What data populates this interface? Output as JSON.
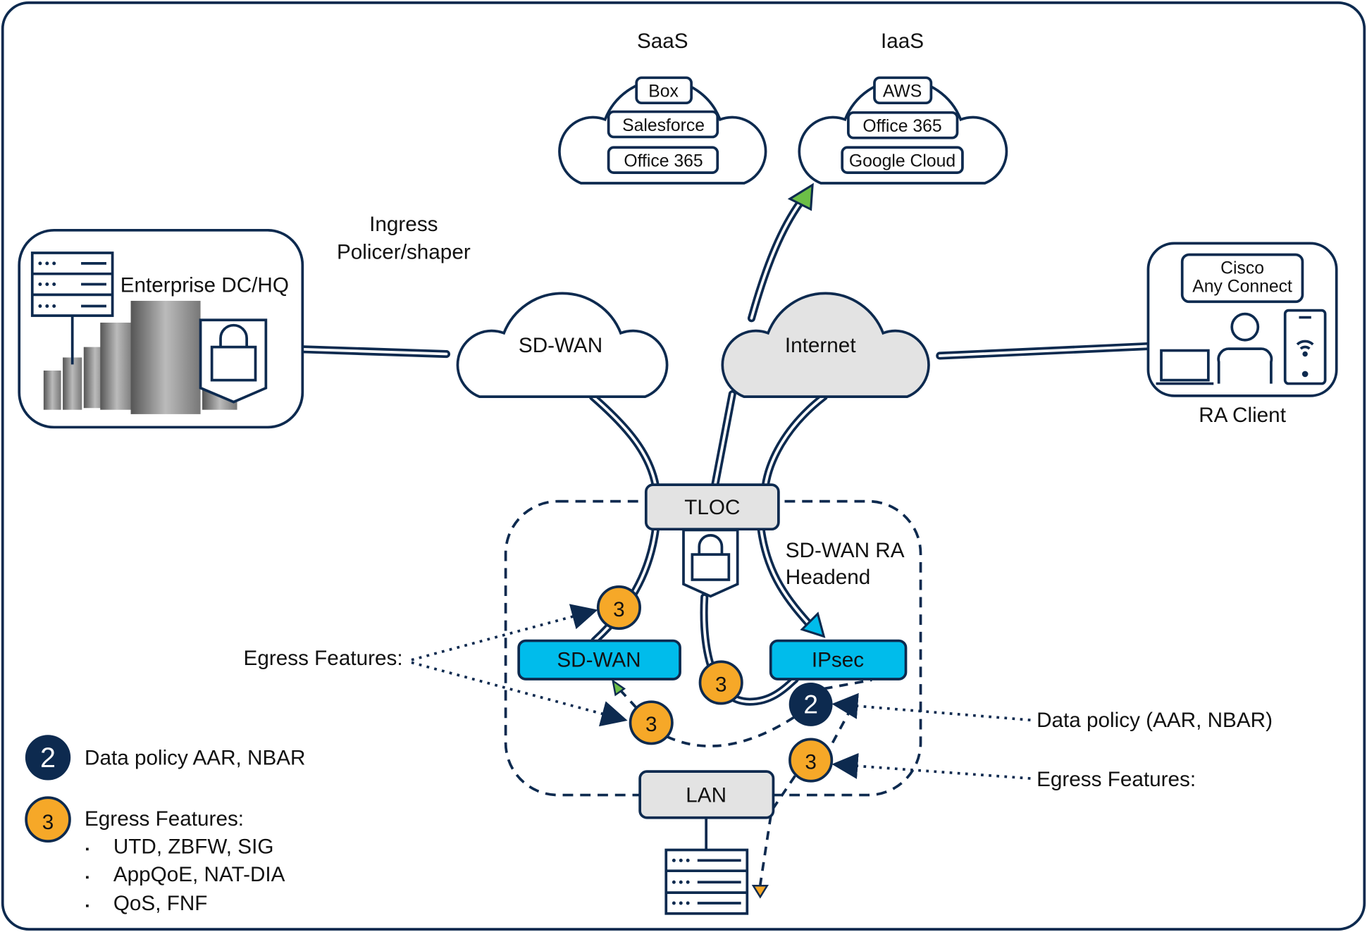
{
  "colors": {
    "navy": "#0d2a4f",
    "cyan": "#00bceb",
    "orange": "#f6a828",
    "gray": "#e3e3e3",
    "green": "#6cbf47"
  },
  "saas": {
    "title": "SaaS",
    "items": [
      "Box",
      "Salesforce",
      "Office 365"
    ]
  },
  "iaas": {
    "title": "IaaS",
    "items": [
      "AWS",
      "Office 365",
      "Google Cloud"
    ]
  },
  "ingress": {
    "line1": "Ingress",
    "line2": "Policer/shaper"
  },
  "enterprise": {
    "label": "Enterprise DC/HQ",
    "icons": [
      "server-icon",
      "datacenter-racks-image",
      "lock-shield-icon"
    ]
  },
  "clouds": {
    "sdwan": "SD-WAN",
    "internet": "Internet"
  },
  "ra_client": {
    "app_line1": "Cisco",
    "app_line2": "Any Connect",
    "label": "RA Client",
    "icons": [
      "laptop-icon",
      "user-icon",
      "mobile-phone-icon"
    ]
  },
  "tloc": "TLOC",
  "headend": {
    "line1": "SD-WAN RA",
    "line2": "Headend"
  },
  "sdwan_box": "SD-WAN",
  "ipsec_box": "IPsec",
  "lan": "LAN",
  "badges": {
    "two": "2",
    "three": "3"
  },
  "callouts": {
    "egress_left": "Egress Features:",
    "data_policy": "Data policy (AAR, NBAR)",
    "egress_right": "Egress Features:"
  },
  "legend": {
    "item2": "Data policy AAR, NBAR",
    "item3": "Egress Features:",
    "bullet": "▪",
    "bullets": [
      "UTD, ZBFW, SIG",
      "AppQoE, NAT-DIA",
      "QoS, FNF"
    ]
  }
}
